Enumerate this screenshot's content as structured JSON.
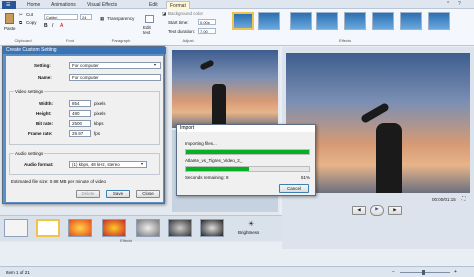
{
  "ribbon": {
    "tabs": [
      "Home",
      "Animations",
      "Visual Effects",
      "Edit",
      "Format"
    ],
    "clipboard": {
      "paste": "Paste",
      "cut": "Cut",
      "copy": "Copy",
      "label": "Clipboard"
    },
    "font": {
      "family": "Calibri",
      "size": "24",
      "label": "Font"
    },
    "paragraph": {
      "transparency": "Transparency",
      "label": "Paragraph"
    },
    "edit_text": "Edit text",
    "adjust": {
      "background_color": "Background color",
      "start_time": "Start time:",
      "start_value": "0.00s",
      "text_duration": "Text duration:",
      "duration_value": "7.00",
      "label": "Adjust"
    },
    "effects_label": "Effects"
  },
  "settings_dialog": {
    "title": "Create Custom Setting",
    "setting_label": "Setting:",
    "setting_value": "For computer",
    "name_label": "Name:",
    "name_value": "For computer",
    "video_settings": "Video settings",
    "width_label": "Width:",
    "width_value": "854",
    "width_unit": "pixels",
    "height_label": "Height:",
    "height_value": "480",
    "height_unit": "pixels",
    "bitrate_label": "Bit rate:",
    "bitrate_value": "2500",
    "bitrate_unit": "kbps",
    "framerate_label": "Frame rate:",
    "framerate_value": "29.97",
    "framerate_unit": "fps",
    "audio_settings": "Audio settings",
    "audio_format_label": "Audio format:",
    "audio_format_value": "(1) kbps, 48 kHz, stereo",
    "estimate": "Estimated file size: 0.88 MB per minute of video",
    "delete": "Delete",
    "save": "Save",
    "close": "Close"
  },
  "import_dialog": {
    "title": "Import",
    "status": "Importing files...",
    "filename": "Atlante_vs_Tigres_Video_2_",
    "seconds_label": "Seconds remaining: 8",
    "percent": "51%",
    "progress_top": 1.0,
    "progress_bottom": 0.51,
    "cancel": "Cancel"
  },
  "player": {
    "time": "00:00/01:15"
  },
  "effects_strip": {
    "brightness": "Brightness",
    "label": "Effects"
  },
  "status": {
    "item": "Item 1 of 21"
  },
  "colors": {
    "accent": "#2b5797",
    "progress": "#06b025"
  }
}
